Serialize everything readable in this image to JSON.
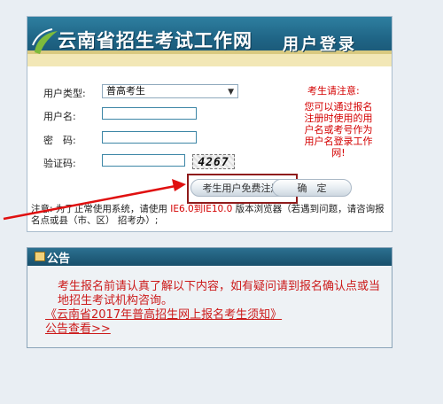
{
  "banner": {
    "site_title": "云南省招生考试工作网",
    "login_title": "用户登录"
  },
  "form": {
    "user_type_label": "用户类型:",
    "user_type_value": "普高考生",
    "username_label": "用户名:",
    "password_label": "密　码:",
    "captcha_label": "验证码:",
    "captcha_value": "4267"
  },
  "note": {
    "title": "考生请注意:",
    "body": "您可以通过报名注册时使用的用户名或考号作为用户名登录工作网!"
  },
  "buttons": {
    "register": "考生用户免费注册",
    "confirm": "确　定"
  },
  "bottom_note": {
    "prefix": "注意: 为了正常使用系统，请使用",
    "browser": "IE6.0到IE10.0",
    "suffix": "版本浏览器（若遇到问题，请咨询报名点或县（市、区） 招考办）;"
  },
  "notice": {
    "title": "公告",
    "body": "考生报名前请认真了解以下内容，如有疑问请到报名确认点或当地招生考试机构咨询。",
    "link1": "《云南省2017年普高招生网上报名考生须知》",
    "link2": "公告查看>>"
  },
  "colors": {
    "banner": "#1f6485",
    "accent_red": "#d40000",
    "highlight": "#8f1b1b"
  }
}
